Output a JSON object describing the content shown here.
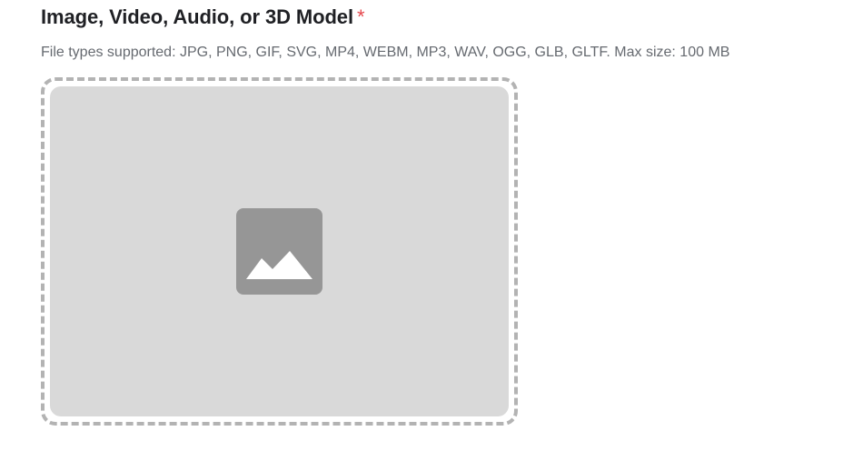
{
  "upload_field": {
    "title": "Image, Video, Audio, or 3D Model",
    "required_marker": "*",
    "help_text": "File types supported: JPG, PNG, GIF, SVG, MP4, WEBM, MP3, WAV, OGG, GLB, GLTF. Max size: 100 MB",
    "placeholder_icon": "image-icon"
  },
  "colors": {
    "title": "#1f2024",
    "required": "#e5484d",
    "help_text": "#666a70",
    "dropzone_border": "#b3b3b3",
    "dropzone_fill": "#d9d9d9",
    "icon": "#969696"
  }
}
